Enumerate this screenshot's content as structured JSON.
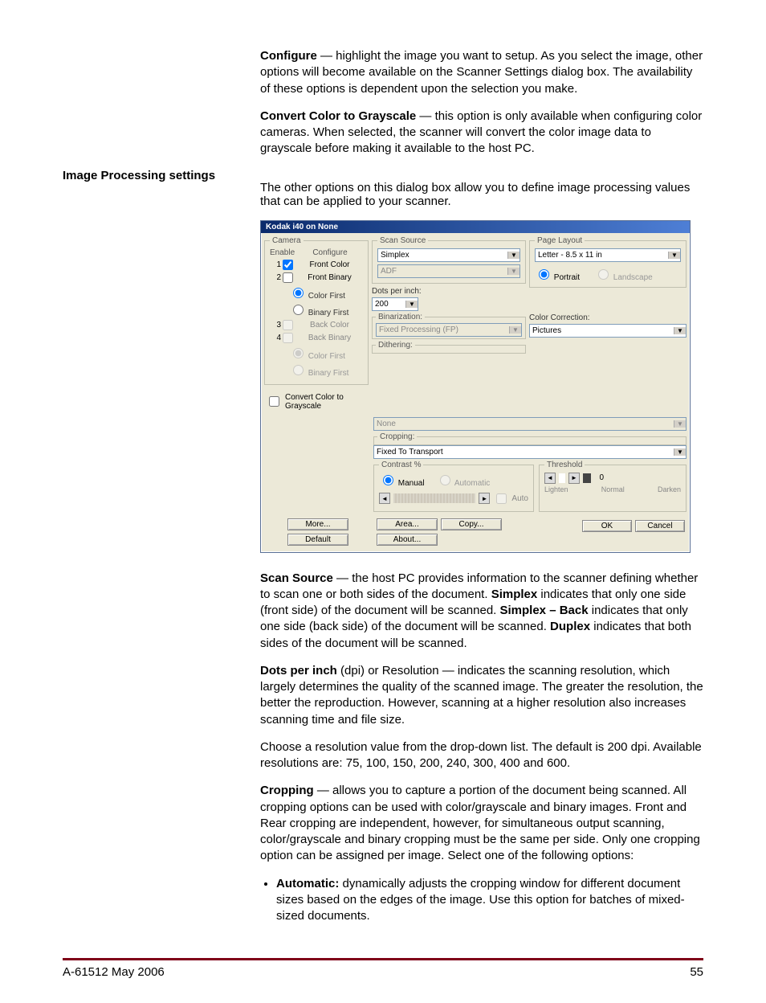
{
  "intro": {
    "configure_title": "Configure",
    "configure_body": " — highlight the image you want to setup. As you select the image, other options will become available on the Scanner Settings dialog box. The availability of these options is dependent upon the selection you make.",
    "cctg_title": "Convert Color to Grayscale",
    "cctg_body": " — this option is only available when configuring color cameras. When selected, the scanner will convert the color image data to grayscale before making it available to the host PC."
  },
  "section_heading": "Image Processing settings",
  "section_lead": "The other options on this dialog box allow you to define image processing values that can be applied to your scanner.",
  "dialog": {
    "title": "Kodak i40 on None",
    "camera": {
      "legend": "Camera",
      "hdr_enable": "Enable",
      "hdr_config": "Configure",
      "rows": [
        {
          "n": "1",
          "checked": true,
          "label": "Front Color",
          "disabled": false
        },
        {
          "n": "2",
          "checked": false,
          "label": "Front Binary",
          "disabled": false
        },
        {
          "n": "3",
          "checked": false,
          "label": "Back Color",
          "disabled": true
        },
        {
          "n": "4",
          "checked": false,
          "label": "Back Binary",
          "disabled": true
        }
      ],
      "radio_color_first": "Color First",
      "radio_binary_first": "Binary First",
      "cctg_label": "Convert Color to Grayscale"
    },
    "scan_source": {
      "legend": "Scan Source",
      "primary": "Simplex",
      "secondary": "ADF"
    },
    "dpi": {
      "label": "Dots per inch:",
      "value": "200"
    },
    "binarization": {
      "legend": "Binarization:",
      "value": "Fixed Processing (FP)"
    },
    "dithering": {
      "legend": "Dithering:",
      "value": "None"
    },
    "cropping": {
      "legend": "Cropping:",
      "value": "Fixed To Transport"
    },
    "contrast": {
      "legend": "Contrast %",
      "manual": "Manual",
      "automatic": "Automatic",
      "auto": "Auto"
    },
    "page_layout": {
      "legend": "Page Layout",
      "size": "Letter - 8.5 x 11 in",
      "portrait": "Portrait",
      "landscape": "Landscape"
    },
    "color_correction": {
      "label": "Color Correction:",
      "value": "Pictures"
    },
    "threshold": {
      "legend": "Threshold",
      "value": "0",
      "lighten": "Lighten",
      "normal": "Normal",
      "darken": "Darken"
    },
    "buttons": {
      "more": "More...",
      "default": "Default",
      "area": "Area...",
      "copy": "Copy...",
      "about": "About...",
      "ok": "OK",
      "cancel": "Cancel"
    }
  },
  "below": {
    "scan_source_1a": "Scan Source",
    "scan_source_1b": " — the host PC provides information to the scanner defining whether to scan one or both sides of the document. ",
    "scan_source_simplex": "Simplex",
    "scan_source_1c": " indicates that only one side (front side) of the document will be scanned. ",
    "scan_source_simplex_back": "Simplex – Back",
    "scan_source_1d": " indicates that only one side (back side) of the document will be scanned. ",
    "scan_source_duplex": "Duplex",
    "scan_source_1e": " indicates that both sides of the document will be scanned.",
    "dpi_a": "Dots per inch",
    "dpi_b": " (dpi) or Resolution — indicates the scanning resolution, which largely determines the quality of the scanned image. The greater the resolution, the better the reproduction. However, scanning at a higher resolution also increases scanning time and file size.",
    "dpi_res": "Choose a resolution value from the drop-down list. The default is 200 dpi. Available resolutions are: 75, 100, 150, 200, 240, 300, 400 and 600.",
    "cropping_a": "Cropping",
    "cropping_b": " — allows you to capture a portion of the document being scanned. All cropping options can be used with color/grayscale and binary images. Front and Rear cropping are independent, however, for simultaneous output scanning, color/grayscale and binary cropping must be the same per side. Only one cropping option can be assigned per image. Select one of the following options:",
    "auto_a": "Automatic:",
    "auto_b": " dynamically adjusts the cropping window for different document sizes based on the edges of the image. Use this option for batches of mixed-sized documents."
  },
  "footer": {
    "left": "A-61512   May 2006",
    "right": "55"
  }
}
